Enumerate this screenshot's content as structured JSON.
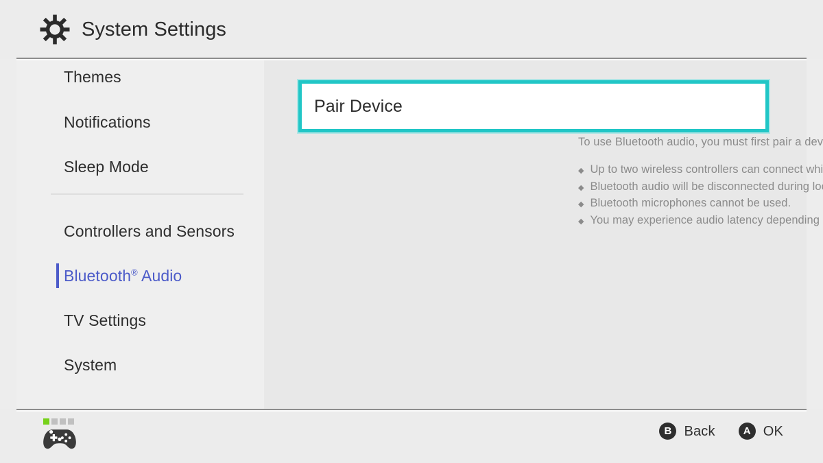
{
  "header": {
    "title": "System Settings",
    "icon": "gear-icon"
  },
  "sidebar": {
    "groups": [
      {
        "items": [
          {
            "label": "Themes",
            "selected": false
          },
          {
            "label": "Notifications",
            "selected": false
          },
          {
            "label": "Sleep Mode",
            "selected": false
          }
        ]
      },
      {
        "items": [
          {
            "label": "Controllers and Sensors",
            "selected": false
          },
          {
            "label": "Bluetooth",
            "superscript": "®",
            "label_suffix": " Audio",
            "selected": true
          },
          {
            "label": "TV Settings",
            "selected": false
          },
          {
            "label": "System",
            "selected": false
          }
        ]
      }
    ]
  },
  "main": {
    "card": {
      "label": "Pair Device",
      "highlighted": true,
      "border_color": "#21c6c6"
    },
    "description": "To use Bluetooth audio, you must first pair a device.",
    "notes": [
      {
        "bullet": "◆",
        "text": "Up to two wireless controllers can connect while using Bluetooth audio."
      },
      {
        "bullet": "◆",
        "text": "Bluetooth audio will be disconnected during local communication."
      },
      {
        "bullet": "◆",
        "text": "Bluetooth microphones cannot be used."
      },
      {
        "bullet": "◆",
        "text": "You may experience audio latency depending on your Bluetooth device."
      }
    ]
  },
  "footer": {
    "controller": {
      "icon": "gamepad-icon",
      "player_indicators": [
        true,
        false,
        false,
        false
      ],
      "active_color": "#76d11a"
    },
    "actions": [
      {
        "button": "B",
        "label": "Back"
      },
      {
        "button": "A",
        "label": "OK"
      }
    ]
  },
  "theme": {
    "accent_selected": "#4c5bc9",
    "accent_highlight": "#21c6c6",
    "text_primary": "#2d2d2d",
    "text_muted": "#8b8b8b",
    "bg_sidebar": "#efefef",
    "bg_main": "#e8e8e8"
  }
}
